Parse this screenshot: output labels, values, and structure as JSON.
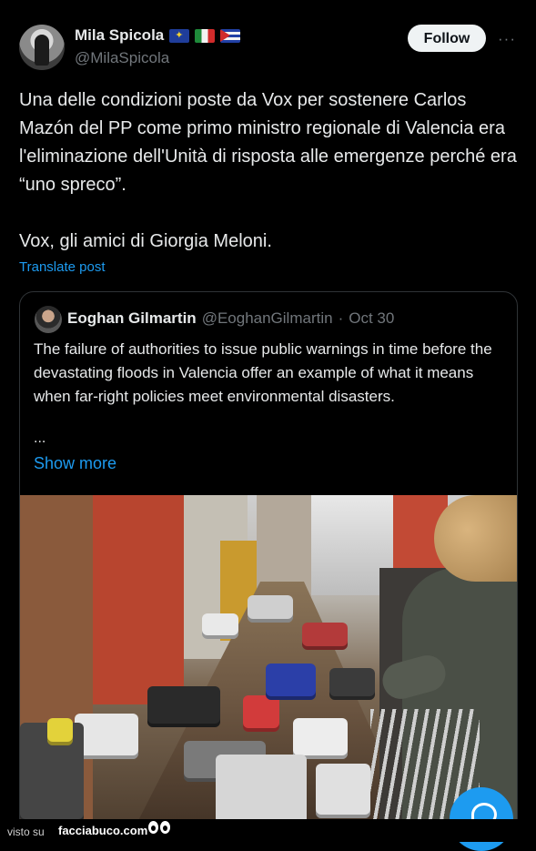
{
  "author": {
    "name": "Mila Spicola",
    "handle": "@MilaSpicola",
    "flags": [
      "eu-flag-icon",
      "italy-flag-icon",
      "cuba-flag-icon"
    ]
  },
  "actions": {
    "follow_label": "Follow",
    "more_icon": "more-icon"
  },
  "tweet": {
    "paragraph_1": "Una delle condizioni poste da Vox per sostenere Carlos Mazón del PP come primo ministro regionale di Valencia era l'eliminazione dell'Unità di risposta alle emergenze perché era “uno spreco”.",
    "paragraph_2": "Vox, gli amici di Giorgia Meloni.",
    "translate_label": "Translate post"
  },
  "quoted": {
    "name": "Eoghan Gilmartin",
    "handle": "@EoghanGilmartin",
    "separator": "·",
    "date": "Oct 30",
    "text": "The failure of authorities to issue public warnings in time before the devastating floods in Valencia offer an example of what it means when far-right policies meet environmental disasters.",
    "ellipsis": "...",
    "show_more": "Show more",
    "image_alt": "flooded-street-photo"
  },
  "footer": {
    "visto": "visto su",
    "brand": "facciabuco.com"
  },
  "colors": {
    "accent": "#1d9bf0",
    "text": "#e7e9ea",
    "muted": "#71767b",
    "background": "#000000"
  }
}
